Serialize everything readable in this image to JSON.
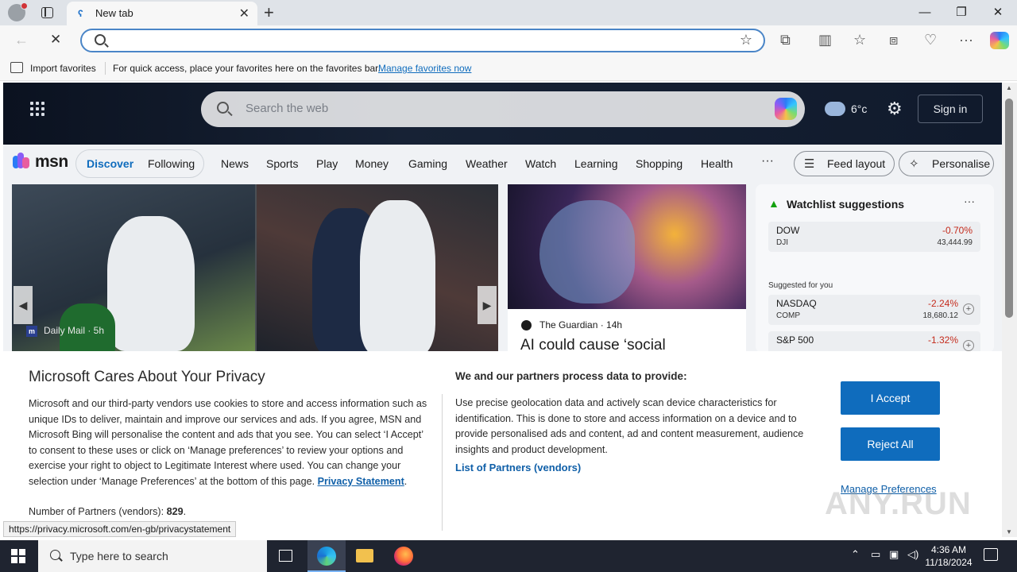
{
  "browser": {
    "tab_title": "New tab",
    "address_value": "",
    "favorites_bar": {
      "import_label": "Import favorites",
      "message": "For quick access, place your favorites here on the favorites bar.",
      "manage_link": "Manage favorites now"
    }
  },
  "msn": {
    "search_placeholder": "Search the web",
    "weather_temp": "6°c",
    "signin_label": "Sign in",
    "logo_text": "msn",
    "feed_tabs": [
      "Discover",
      "Following"
    ],
    "nav_items": [
      "News",
      "Sports",
      "Play",
      "Money",
      "Gaming",
      "Weather",
      "Watch",
      "Learning",
      "Shopping",
      "Health"
    ],
    "nav_more": "···",
    "feed_layout_label": "Feed layout",
    "personalise_label": "Personalise",
    "main_card": {
      "source": "Daily Mail · 5h",
      "source_badge": "m"
    },
    "ai_card": {
      "source": "The Guardian · 14h",
      "headline": "AI could cause ‘social"
    },
    "watchlist": {
      "title": "Watchlist suggestions",
      "more": "···",
      "suggested_label": "Suggested for you",
      "stocks": [
        {
          "symbol": "DOW",
          "sub": "DJI",
          "change": "-0.70%",
          "value": "43,444.99"
        },
        {
          "symbol": "NASDAQ",
          "sub": "COMP",
          "change": "-2.24%",
          "value": "18,680.12"
        },
        {
          "symbol": "S&P 500",
          "sub": "",
          "change": "-1.32%",
          "value": ""
        }
      ]
    }
  },
  "privacy": {
    "title": "Microsoft Cares About Your Privacy",
    "body": "Microsoft and our third-party vendors use cookies to store and access information such as unique IDs to deliver, maintain and improve our services and ads. If you agree, MSN and Microsoft Bing will personalise the content and ads that you see. You can select ‘I Accept’ to consent to these uses or click on ‘Manage preferences’ to review your options and exercise your right to object to Legitimate Interest where used.  You can change your selection under ‘Manage Preferences’ at the bottom of this page. ",
    "privacy_link": "Privacy Statement",
    "partners_label": "Number of Partners (vendors): ",
    "partners_count": "829",
    "partners_suffix": ".",
    "heading2": "We and our partners process data to provide:",
    "description": "Use precise geolocation data and actively scan device characteristics for identification. This is done to store and access information on a device and to provide personalised ads and content, ad and content measurement, audience insights and product development.",
    "list_link": "List of Partners (vendors)",
    "accept_label": "I Accept",
    "reject_label": "Reject All",
    "manage_label": "Manage Preferences"
  },
  "status_url": "https://privacy.microsoft.com/en-gb/privacystatement",
  "watermark": "ANY.RUN",
  "taskbar": {
    "search_placeholder": "Type here to search",
    "time": "4:36 AM",
    "date": "11/18/2024"
  },
  "colors": {
    "accent": "#0f6cbd",
    "negative": "#c42b1c",
    "taskbar": "#1f2430"
  }
}
